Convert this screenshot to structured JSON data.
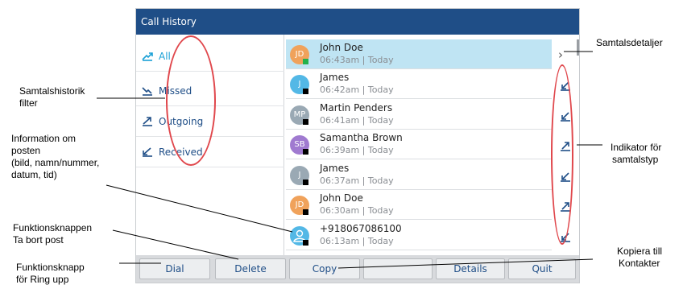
{
  "screen": {
    "title": "Call History",
    "filters": [
      {
        "label": "All",
        "icon": "all-calls-icon",
        "active": true
      },
      {
        "label": "Missed",
        "icon": "missed-call-icon",
        "active": false
      },
      {
        "label": "Outgoing",
        "icon": "outgoing-call-icon",
        "active": false
      },
      {
        "label": "Received",
        "icon": "received-call-icon",
        "active": false
      }
    ],
    "entries": [
      {
        "initials": "JD",
        "avatar_color": "#f0a25b",
        "presence": "green",
        "name": "John Doe",
        "time": "06:43am | Today",
        "selected": true,
        "type": "details"
      },
      {
        "initials": "J",
        "avatar_color": "#53b8e6",
        "presence": "black",
        "name": "James",
        "time": "06:42am | Today",
        "selected": false,
        "type": "received"
      },
      {
        "initials": "MP",
        "avatar_color": "#9aa9b4",
        "presence": "black",
        "name": "Martin Penders",
        "time": "06:41am | Today",
        "selected": false,
        "type": "received"
      },
      {
        "initials": "SB",
        "avatar_color": "#a07ad0",
        "presence": "black",
        "name": "Samantha Brown",
        "time": "06:39am | Today",
        "selected": false,
        "type": "outgoing"
      },
      {
        "initials": "J",
        "avatar_color": "#9aa9b4",
        "presence": "black",
        "name": "James",
        "time": "06:37am | Today",
        "selected": false,
        "type": "received"
      },
      {
        "initials": "JD",
        "avatar_color": "#f0a25b",
        "presence": "black",
        "name": "John Doe",
        "time": "06:30am | Today",
        "selected": false,
        "type": "outgoing"
      },
      {
        "initials": "",
        "avatar_color": "#53b8e6",
        "presence": "black",
        "name": "+918067086100",
        "time": "06:13am | Today",
        "selected": false,
        "type": "received"
      }
    ],
    "softkeys": [
      "Dial",
      "Delete",
      "Copy",
      "",
      "Details",
      "Quit"
    ]
  },
  "annotations": {
    "details": "Samtalsdetaljer",
    "filter_line1": "Samtalshistorik",
    "filter_line2": "filter",
    "info_line1": "Information om",
    "info_line2": "posten",
    "info_line3": "(bild, namn/nummer,",
    "info_line4": "datum, tid)",
    "type_line1": "Indikator för",
    "type_line2": "samtalstyp",
    "delete_line1": "Funktionsknappen",
    "delete_line2": " Ta bort post",
    "dial_line1": "Funktionsknapp",
    "dial_line2": "för Ring upp",
    "copy_line1": "Kopiera till",
    "copy_line2": "Kontakter"
  },
  "colors": {
    "titlebar": "#1f4e87",
    "selected_row": "#bfe4f3",
    "annotation_ring": "#e0474c"
  }
}
